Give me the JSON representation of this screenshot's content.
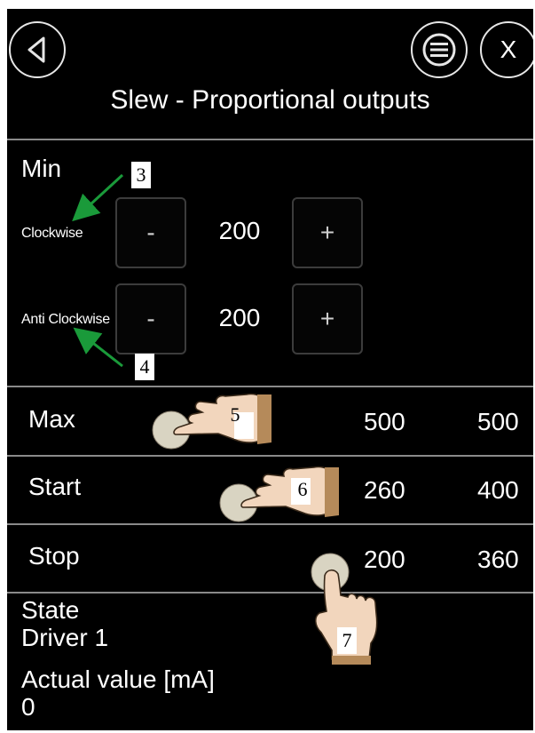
{
  "header": {
    "title": "Slew  - Proportional outputs",
    "back_icon": "back-arrow-icon",
    "menu_icon": "hamburger-menu-icon",
    "close_label": "X"
  },
  "min_section": {
    "heading": "Min",
    "rows": [
      {
        "label": "Clockwise",
        "minus": "-",
        "value": "200",
        "plus": "+"
      },
      {
        "label": "Anti Clockwise",
        "minus": "-",
        "value": "200",
        "plus": "+"
      }
    ]
  },
  "table": [
    {
      "label": "Max",
      "value1": "500",
      "value2": "500"
    },
    {
      "label": "Start",
      "value1": "260",
      "value2": "400"
    },
    {
      "label": "Stop",
      "value1": "200",
      "value2": "360"
    }
  ],
  "status": {
    "state_label": "State",
    "driver": "Driver 1",
    "actual_label": "Actual value [mA]",
    "actual_value": "0"
  },
  "annotations": {
    "n3": "3",
    "n4": "4",
    "n5": "5",
    "n6": "6",
    "n7": "7",
    "arrow_color": "#1a9a3a"
  }
}
